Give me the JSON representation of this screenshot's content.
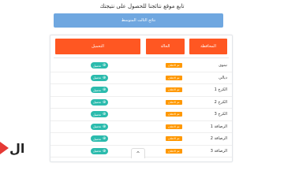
{
  "page": {
    "intro_text": "تابع موقع نتائجنا للحصول على نتيجتك",
    "stage_button": "نتائج الثالث المتوسط"
  },
  "table": {
    "headers": {
      "governorate": "المحافظة",
      "status": "الحالة",
      "download": "التحميل"
    },
    "rows": [
      {
        "name": "نينوى",
        "status": "تم الاعلان",
        "action": "تحميل"
      },
      {
        "name": "ديالى",
        "status": "تم الاعلان",
        "action": "تحميل"
      },
      {
        "name": "الكرخ 1",
        "status": "تم الاعلان",
        "action": "تحميل"
      },
      {
        "name": "الكرخ 2",
        "status": "تم الاعلان",
        "action": "تحميل"
      },
      {
        "name": "الكرخ 3",
        "status": "تم الاعلان",
        "action": "تحميل"
      },
      {
        "name": "الرصافة 1",
        "status": "تم الاعلان",
        "action": "تحميل"
      },
      {
        "name": "الرصافة 2",
        "status": "تم الاعلان",
        "action": "تحميل"
      },
      {
        "name": "الرصافة 3",
        "status": "تم الاعلان",
        "action": "تحميل"
      }
    ]
  },
  "colors": {
    "header_button": "#ff5722",
    "stage_button": "#6fa7e0",
    "status_badge": "#ff9800",
    "download_button": "#2bbbad"
  },
  "icons": {
    "logo": "play-logo-icon",
    "scroll": "chevron-up-icon"
  }
}
